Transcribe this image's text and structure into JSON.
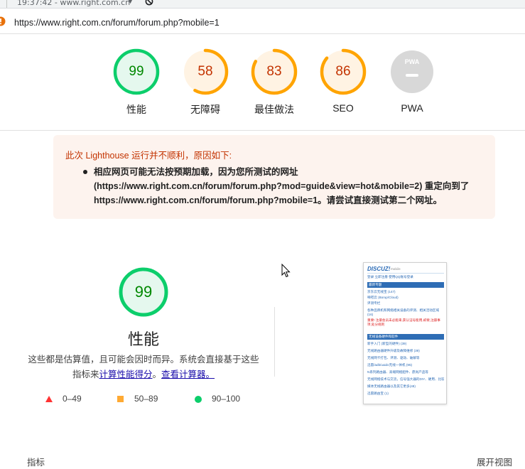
{
  "status_bar": {
    "timestamp": "19:37:42 - www.right.com.cn",
    "dropdown_glyph": "▼",
    "block_icon": "no-entry-icon"
  },
  "url_bar": {
    "url": "https://www.right.com.cn/forum/forum.php?mobile=1",
    "icon": "warning-icon"
  },
  "scores": [
    {
      "value": "99",
      "label": "性能",
      "percent": 99,
      "color": "#0cce6b",
      "bg": "#e5f8ee",
      "text_color": "#008800"
    },
    {
      "value": "58",
      "label": "无障碍",
      "percent": 58,
      "color": "#ffa400",
      "bg": "#fff3e3",
      "text_color": "#c33300"
    },
    {
      "value": "83",
      "label": "最佳做法",
      "percent": 83,
      "color": "#ffa400",
      "bg": "#fff3e3",
      "text_color": "#c33300"
    },
    {
      "value": "86",
      "label": "SEO",
      "percent": 86,
      "color": "#ffa400",
      "bg": "#fff3e3",
      "text_color": "#c33300"
    },
    {
      "value": "",
      "label": "PWA",
      "percent": 0,
      "color": "#cccccc",
      "bg": "#d8d8d8",
      "text_color": "#ffffff",
      "badge": "PWA"
    }
  ],
  "warning": {
    "title": "此次 Lighthouse 运行并不顺利，原因如下:",
    "message": "相应网页可能无法按预期加载，因为您所测试的网址 (https://www.right.com.cn/forum/forum.php?mod=guide&view=hot&mobile=2) 重定向到了 https://www.right.com.cn/forum/forum.php?mobile=1。请尝试直接测试第二个网址。"
  },
  "performance": {
    "score": "99",
    "title": "性能",
    "desc_prefix": "这些都是估算值，且可能会因时而异。系统会直接基于这些指标来",
    "link_calc_score": "计算性能得分",
    "desc_mid": "。",
    "link_calculator": "查看计算器。",
    "score_percent": 99
  },
  "legend": [
    {
      "range": "0–49",
      "shape": "triangle",
      "color": "#ff3333"
    },
    {
      "range": "50–89",
      "shape": "square",
      "color": "#ffaa33"
    },
    {
      "range": "90–100",
      "shape": "circle",
      "color": "#0cce6b"
    }
  ],
  "thumbnail": {
    "logo": "DISCUZ!",
    "logo_sub": "mobile",
    "login_text": "登录 立即注册 使用QQ账号登录",
    "section1": "最新专题",
    "rows1": [
      "京东云无线宝 (147)",
      "嘀嗒云 (Borup/Cloud)",
      "评测专栏"
    ],
    "row_long": "各种品牌机和网络相关设备的评测、相关活动区域 (16)",
    "red_text": "重要! 注册会员未必能来,获认证号能用,却要,注册事项,处分规则",
    "section2": "无线设备硬件和软件",
    "rows2": [
      "新手入门 (新型的硬件) (39)",
      "无线路由器硬件升级及故障维修 (39)",
      "无线网卡打包、评测、驱动、破解等",
      "迅雷/adb/uaido无线一体机 (95)",
      "N系列路由器、高端网络配件、鼎尚产品等",
      "无线网络技术与交流，信号强大器的DIY、硬用、比较",
      "媒体无线路由器以及其它更多(48)",
      "迅雷路由宝 (1)"
    ]
  },
  "footer": {
    "left": "指标",
    "right": "展开视图"
  }
}
